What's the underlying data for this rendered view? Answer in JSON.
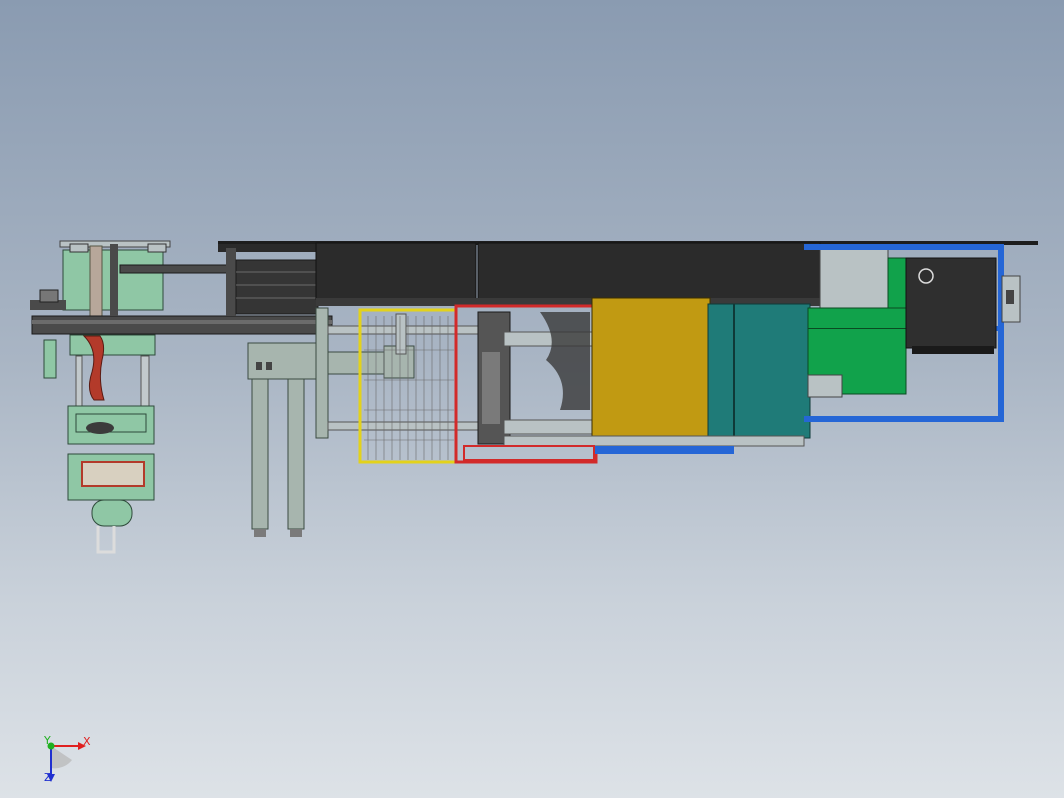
{
  "viewport": {
    "background_top": "#8a9bb1",
    "background_bottom": "#dde2e7"
  },
  "triad": {
    "x_label": "X",
    "y_label": "Y",
    "z_label": "Z",
    "x_color": "#e02020",
    "y_color": "#20b020",
    "z_color": "#2030d0"
  },
  "colors": {
    "frame_dark": "#3a3a3a",
    "panel_black": "#2b2b2b",
    "machine_green": "#8fc7a5",
    "furnace_red": "#b33a2a",
    "mold_yellow": "#c19a12",
    "mold_teal": "#1f7b78",
    "cabinet_green": "#11a24b",
    "frame_blue": "#2566d6",
    "guard_yellow": "#e3d21a",
    "guard_red": "#d22a2a",
    "steel_grey": "#b9c2c4",
    "cylinder_grey": "#a7b5ae"
  }
}
